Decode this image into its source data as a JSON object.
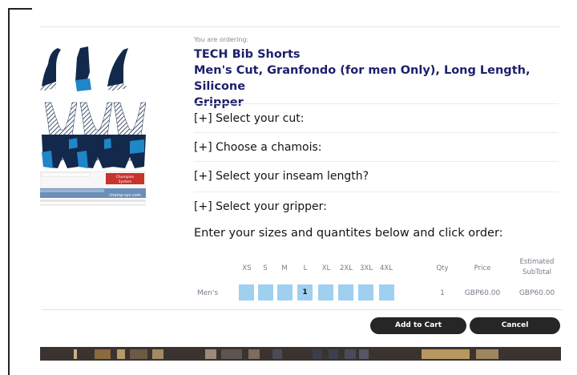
{
  "order": {
    "eyebrow": "You are ordering:",
    "title_line1": "TECH Bib Shorts",
    "title_line2": "Men's Cut, Granfondo (for men Only), Long Length, Silicone",
    "title_line3": "Gripper"
  },
  "options": [
    {
      "label": "[+] Select your cut:"
    },
    {
      "label": "[+] Choose a chamois:"
    },
    {
      "label": "[+] Select your inseam length?"
    },
    {
      "label": "[+] Select your gripper:"
    }
  ],
  "instructions": "Enter your sizes and quantites below and click order:",
  "size_table": {
    "sizes": [
      "XS",
      "S",
      "M",
      "L",
      "XL",
      "2XL",
      "3XL",
      "4XL"
    ],
    "qty_header": "Qty",
    "price_header": "Price",
    "subtotal_header_line1": "Estimated",
    "subtotal_header_line2": "SubTotal",
    "row": {
      "label": "Men's",
      "values": [
        "",
        "",
        "",
        "1",
        "",
        "",
        "",
        ""
      ],
      "qty": "1",
      "price": "GBP60.00",
      "subtotal": "GBP60.00"
    }
  },
  "buttons": {
    "add_to_cart": "Add to Cart",
    "cancel": "Cancel"
  },
  "product_sheet": {
    "brand_line1": "Champion",
    "brand_line2": "System",
    "url": "champ-sys.com"
  },
  "colors": {
    "title": "#1d1f6b",
    "size_box": "#9fd0f0",
    "button": "#262626",
    "kit_blue": "#1f86c7",
    "kit_navy": "#13294b"
  }
}
